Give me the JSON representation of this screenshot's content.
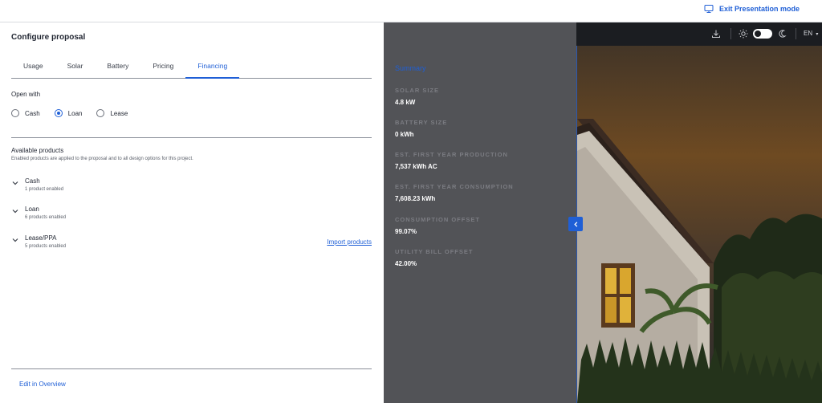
{
  "topbar": {
    "exit_label": "Exit Presentation mode",
    "exit_icon": "presentation-icon"
  },
  "panel": {
    "title": "Configure proposal",
    "tabs": [
      "Usage",
      "Solar",
      "Battery",
      "Pricing",
      "Financing"
    ],
    "active_tab": "Financing",
    "open_with_label": "Open with",
    "open_with_options": [
      "Cash",
      "Loan",
      "Lease"
    ],
    "open_with_selected": "Loan",
    "available_title": "Available products",
    "available_desc": "Enabled products are applied to the proposal and to all design options for this project.",
    "groups": [
      {
        "name": "Cash",
        "sub": "1 product enabled"
      },
      {
        "name": "Loan",
        "sub": "6 products enabled"
      },
      {
        "name": "Lease/PPA",
        "sub": "5 products enabled"
      }
    ],
    "import_label": "Import products",
    "edit_label": "Edit in Overview"
  },
  "summary": {
    "title": "Summary",
    "metrics": [
      {
        "label": "SOLAR SIZE",
        "value": "4.8 kW"
      },
      {
        "label": "BATTERY SIZE",
        "value": "0 kWh"
      },
      {
        "label": "EST. FIRST YEAR PRODUCTION",
        "value": "7,537 kWh AC"
      },
      {
        "label": "EST. FIRST YEAR CONSUMPTION",
        "value": "7,608.23 kWh"
      },
      {
        "label": "CONSUMPTION OFFSET",
        "value": "99.07%"
      },
      {
        "label": "UTILITY BILL OFFSET",
        "value": "42.00%"
      }
    ]
  },
  "viewer": {
    "language": "EN",
    "icons": [
      "download-icon",
      "sun-icon",
      "moon-icon"
    ],
    "theme_toggle_on": true
  },
  "colors": {
    "accent": "#1f5fd6",
    "summary_bg": "#525357",
    "toolbar_bg": "#1b1d21"
  }
}
